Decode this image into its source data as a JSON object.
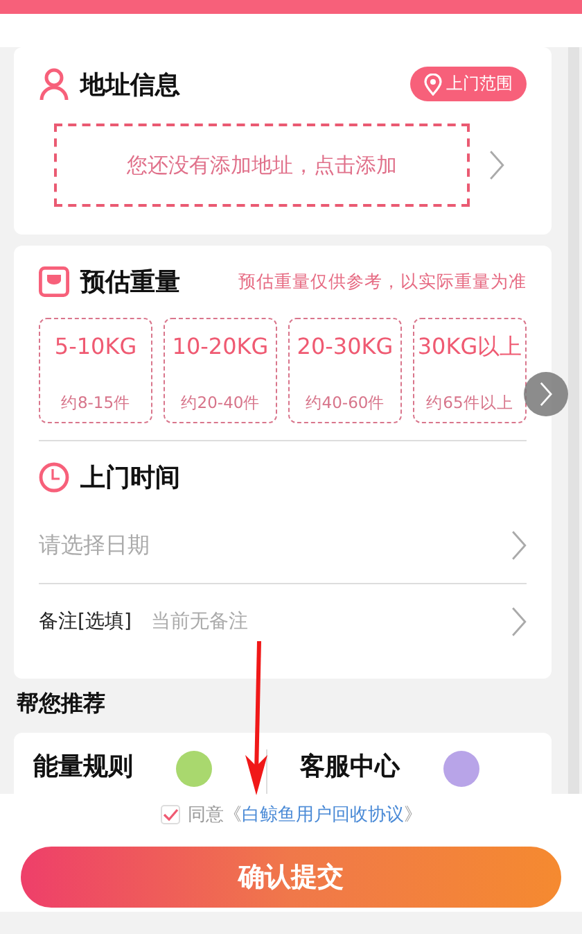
{
  "address": {
    "title": "地址信息",
    "range_button": "上门范围",
    "placeholder": "您还没有添加地址，点击添加"
  },
  "weight": {
    "title": "预估重量",
    "note": "预估重量仅供参考，以实际重量为准",
    "options": [
      {
        "range": "5-10KG",
        "count": "约8-15件"
      },
      {
        "range": "10-20KG",
        "count": "约20-40件"
      },
      {
        "range": "20-30KG",
        "count": "约40-60件"
      },
      {
        "range": "30KG以上",
        "count": "约65件以上"
      }
    ]
  },
  "time": {
    "title": "上门时间",
    "placeholder": "请选择日期"
  },
  "remark": {
    "label": "备注[选填]",
    "value": "当前无备注"
  },
  "recommend": {
    "title": "帮您推荐",
    "items": [
      {
        "label": "能量规则"
      },
      {
        "label": "客服中心"
      }
    ]
  },
  "agreement": {
    "checked": true,
    "prefix": "同意《",
    "link": "白鲸鱼用户回收协议",
    "suffix": "》"
  },
  "submit": "确认提交"
}
